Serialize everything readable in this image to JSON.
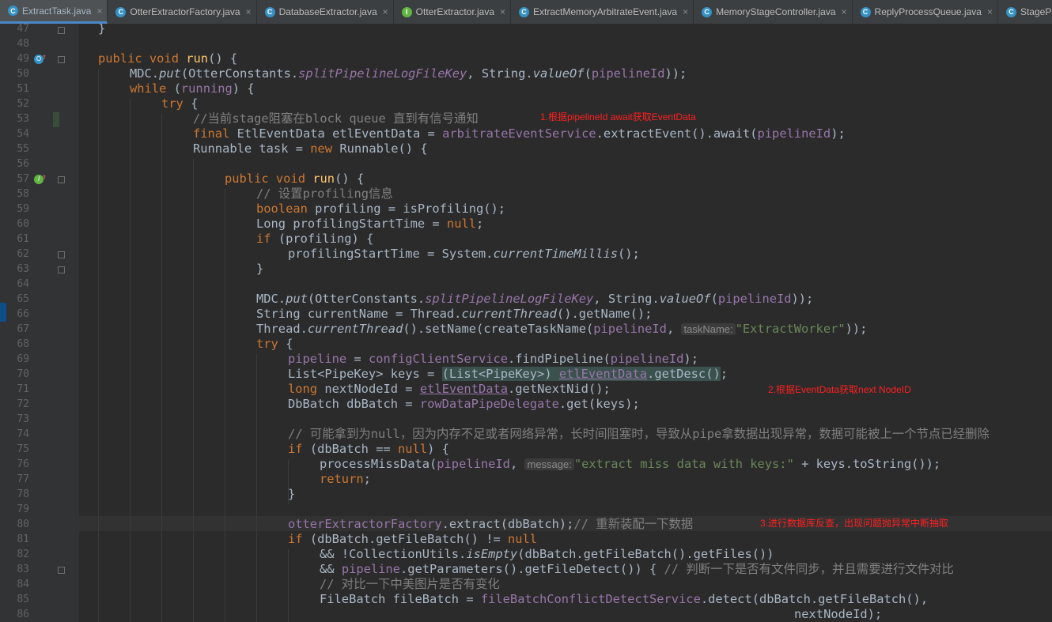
{
  "tabs": [
    {
      "icon": "C",
      "label": "ExtractTask.java",
      "active": true
    },
    {
      "icon": "C",
      "label": "OtterExtractorFactory.java"
    },
    {
      "icon": "C",
      "label": "DatabaseExtractor.java"
    },
    {
      "icon": "I",
      "label": "OtterExtractor.java"
    },
    {
      "icon": "C",
      "label": "ExtractMemoryArbitrateEvent.java"
    },
    {
      "icon": "C",
      "label": "MemoryStageController.java"
    },
    {
      "icon": "C",
      "label": "ReplyProcessQueue.java"
    },
    {
      "icon": "C",
      "label": "StageProgre"
    }
  ],
  "tab_close": "×",
  "line_numbers": [
    "47",
    "48",
    "49",
    "50",
    "51",
    "52",
    "53",
    "54",
    "55",
    "56",
    "57",
    "58",
    "59",
    "60",
    "61",
    "62",
    "63",
    "64",
    "65",
    "66",
    "67",
    "68",
    "69",
    "70",
    "71",
    "72",
    "73",
    "74",
    "75",
    "76",
    "77",
    "78",
    "79",
    "80",
    "81",
    "82",
    "83",
    "84",
    "85",
    "86"
  ],
  "code": {
    "l47": [
      "}"
    ],
    "l49": [
      "public",
      "void",
      "run",
      "() {"
    ],
    "l50": [
      "MDC.",
      "put",
      "(OtterConstants.",
      "splitPipelineLogFileKey",
      ", String.",
      "valueOf",
      "(",
      "pipelineId",
      "));"
    ],
    "l51": [
      "while",
      " (",
      "running",
      ") {"
    ],
    "l52": [
      "try",
      " {"
    ],
    "l53": [
      "//当前stage阻塞在block queue 直到有信号通知"
    ],
    "l54": [
      "final",
      " EtlEventData etlEventData = ",
      "arbitrateEventService",
      ".extractEvent().await(",
      "pipelineId",
      ");"
    ],
    "l55": [
      "Runnable task = ",
      "new",
      " Runnable() {"
    ],
    "l57": [
      "public",
      "void",
      "run",
      "() {"
    ],
    "l58": [
      "// 设置profiling信息"
    ],
    "l59": [
      "boolean",
      " profiling = isProfiling();"
    ],
    "l60": [
      "Long profilingStartTime = ",
      "null",
      ";"
    ],
    "l61": [
      "if",
      " (profiling) {"
    ],
    "l62": [
      "profilingStartTime = System.",
      "currentTimeMillis",
      "();"
    ],
    "l63": [
      "}"
    ],
    "l65": [
      "MDC.",
      "put",
      "(OtterConstants.",
      "splitPipelineLogFileKey",
      ", String.",
      "valueOf",
      "(",
      "pipelineId",
      "));"
    ],
    "l66": [
      "String currentName = Thread.",
      "currentThread",
      "().getName();"
    ],
    "l67": [
      "Thread.",
      "currentThread",
      "().setName(createTaskName(",
      "pipelineId",
      ", ",
      "taskName:",
      "\"ExtractWorker\"",
      "));"
    ],
    "l68": [
      "try",
      " {"
    ],
    "l69": [
      "pipeline",
      " = ",
      "configClientService",
      ".findPipeline(",
      "pipelineId",
      ");"
    ],
    "l70": [
      "List<PipeKey> keys = ",
      "(List<PipeKey>) ",
      "etlEventData",
      ".getDesc()",
      ";"
    ],
    "l71": [
      "long",
      " nextNodeId = ",
      "etlEventData",
      ".getNextNid();"
    ],
    "l72": [
      "DbBatch dbBatch = ",
      "rowDataPipeDelegate",
      ".get(keys);"
    ],
    "l74": [
      "// 可能拿到为null，因为内存不足或者网络异常，长时间阻塞时，导致从pipe拿数据出现异常，数据可能被上一个节点已经删除"
    ],
    "l75": [
      "if",
      " (dbBatch == ",
      "null",
      ") {"
    ],
    "l76": [
      "processMissData(",
      "pipelineId",
      ", ",
      "message:",
      "\"extract miss data with keys:\"",
      " + keys.toString());"
    ],
    "l77": [
      "return",
      ";"
    ],
    "l78": [
      "}"
    ],
    "l80": [
      "otterExtractorFactory",
      ".extract(dbBatch);",
      "// 重新装配一下数据"
    ],
    "l81": [
      "if",
      " (dbBatch.getFileBatch() != ",
      "null"
    ],
    "l82": [
      "&& !CollectionUtils.",
      "isEmpty",
      "(dbBatch.getFileBatch().getFiles())"
    ],
    "l83": [
      "&& ",
      "pipeline",
      ".getParameters().getFileDetect()) { ",
      "// 判断一下是否有文件同步，并且需要进行文件对比"
    ],
    "l84": [
      "// 对比一下中美图片是否有变化"
    ],
    "l85": [
      "FileBatch fileBatch = ",
      "fileBatchConflictDetectService",
      ".detect(dbBatch.getFileBatch(),"
    ],
    "l86": [
      "nextNodeId);"
    ]
  },
  "annotations": {
    "a1": "1.根据pipelineId  await获取EventData",
    "a2": "2.根据EventData获取next NodeID",
    "a3": "3.进行数据库反查，出现问题抛异常中断抽取"
  },
  "gutter_marks": {
    "override": "O",
    "implement": "I",
    "arrow": "↑"
  },
  "colors": {
    "keyword": "#cc7832",
    "method": "#ffc66d",
    "field": "#9876aa",
    "comment": "#808080",
    "string": "#6a8759",
    "annotation": "#ff2020"
  }
}
